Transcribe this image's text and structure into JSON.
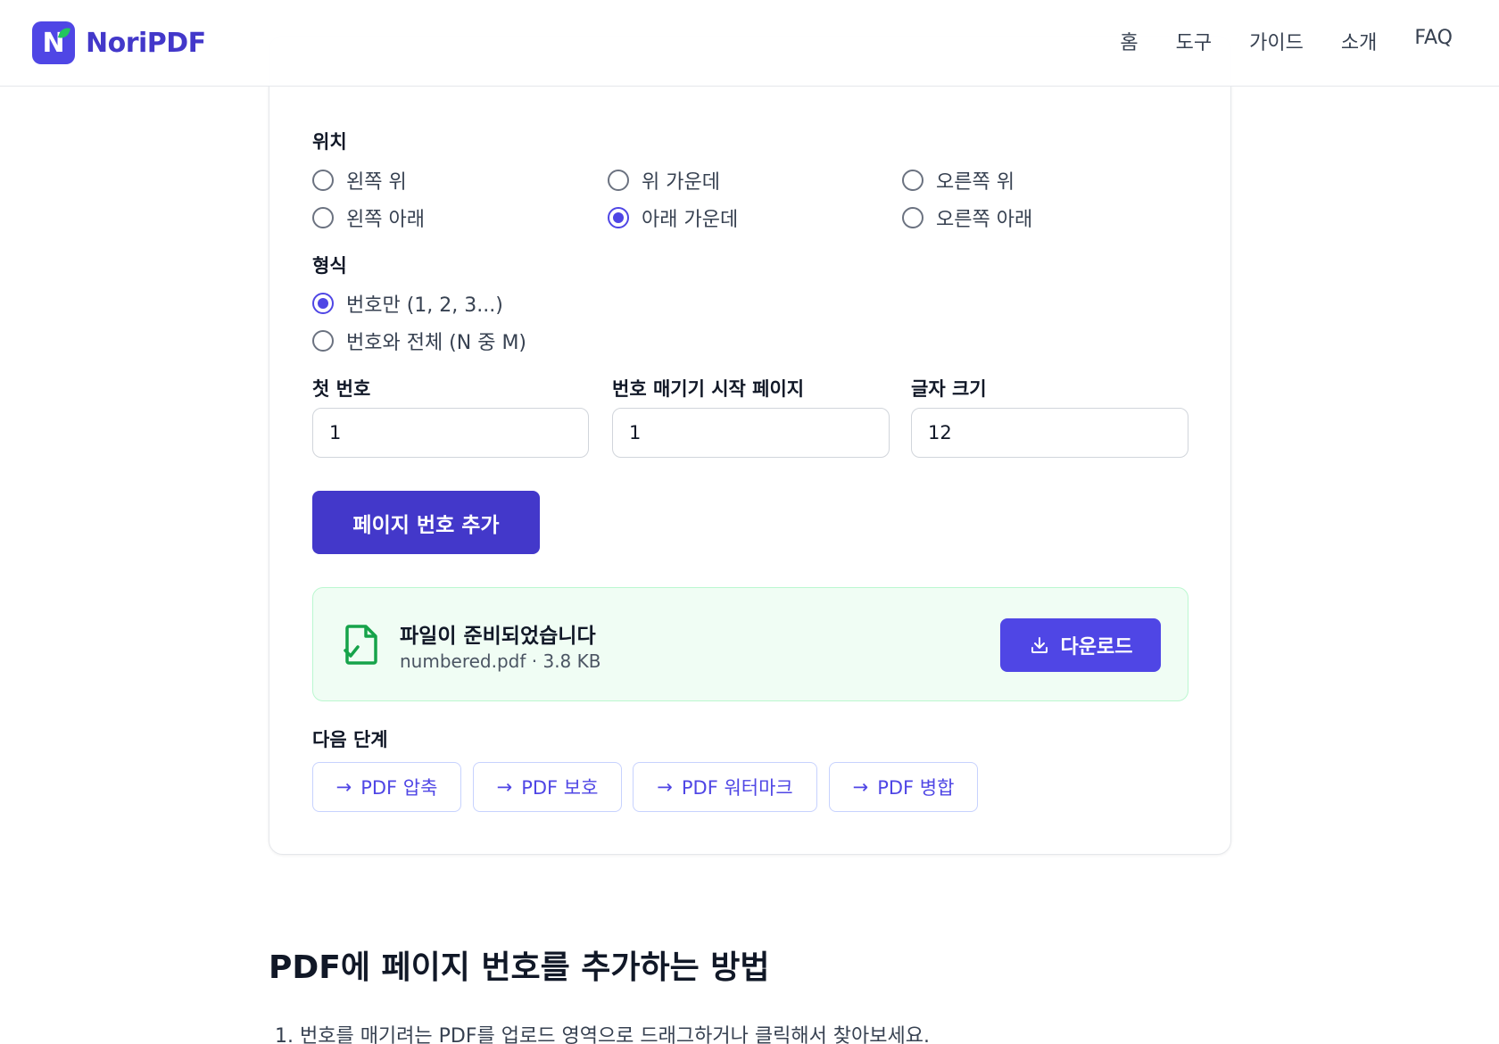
{
  "header": {
    "logo_letter": "N",
    "brand": "NoriPDF",
    "nav": [
      "홈",
      "도구",
      "가이드",
      "소개",
      "FAQ"
    ]
  },
  "position": {
    "label": "위치",
    "options": [
      "왼쪽 위",
      "위 가운데",
      "오른쪽 위",
      "왼쪽 아래",
      "아래 가운데",
      "오른쪽 아래"
    ],
    "selected": "아래 가운데"
  },
  "format": {
    "label": "형식",
    "options": [
      "번호만 (1, 2, 3...)",
      "번호와 전체 (N 중 M)"
    ],
    "selected": "번호만 (1, 2, 3...)"
  },
  "fields": {
    "first_number": {
      "label": "첫 번호",
      "value": "1"
    },
    "start_page": {
      "label": "번호 매기기 시작 페이지",
      "value": "1"
    },
    "font_size": {
      "label": "글자 크기",
      "value": "12"
    }
  },
  "primary_button": "페이지 번호 추가",
  "result": {
    "title": "파일이 준비되었습니다",
    "meta": "numbered.pdf · 3.8 KB",
    "download": "다운로드"
  },
  "next_steps": {
    "label": "다음 단계",
    "items": [
      "PDF 압축",
      "PDF 보호",
      "PDF 워터마크",
      "PDF 병합"
    ]
  },
  "guide": {
    "title": "PDF에 페이지 번호를 추가하는 방법",
    "step1": "1. 번호를 매기려는 PDF를 업로드 영역으로 드래그하거나 클릭해서 찾아보세요."
  },
  "colors": {
    "accent": "#4f46e5",
    "accent_dark": "#4338ca",
    "success_bg": "#f0fdf4",
    "success_icon": "#16a34a"
  }
}
